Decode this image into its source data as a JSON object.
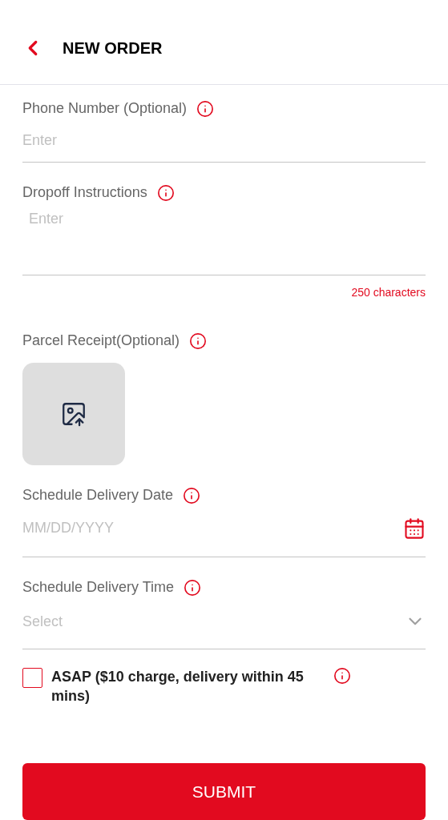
{
  "header": {
    "title": "NEW ORDER"
  },
  "fields": [
    {
      "kind": "text",
      "label": "Phone Number (Optional)",
      "placeholder": "Enter"
    },
    {
      "kind": "textarea",
      "label": "Dropoff Instructions",
      "placeholder": "Enter",
      "counter": "250 characters"
    },
    {
      "kind": "upload",
      "label": "Parcel Receipt(Optional)"
    },
    {
      "kind": "date",
      "label": "Schedule Delivery Date",
      "placeholder": "MM/DD/YYYY"
    },
    {
      "kind": "select",
      "label": "Schedule Delivery Time",
      "placeholder": "Select"
    }
  ],
  "asap": {
    "label": "ASAP ($10 charge, delivery within 45 mins)",
    "checked": false
  },
  "submit": "SUBMIT"
}
